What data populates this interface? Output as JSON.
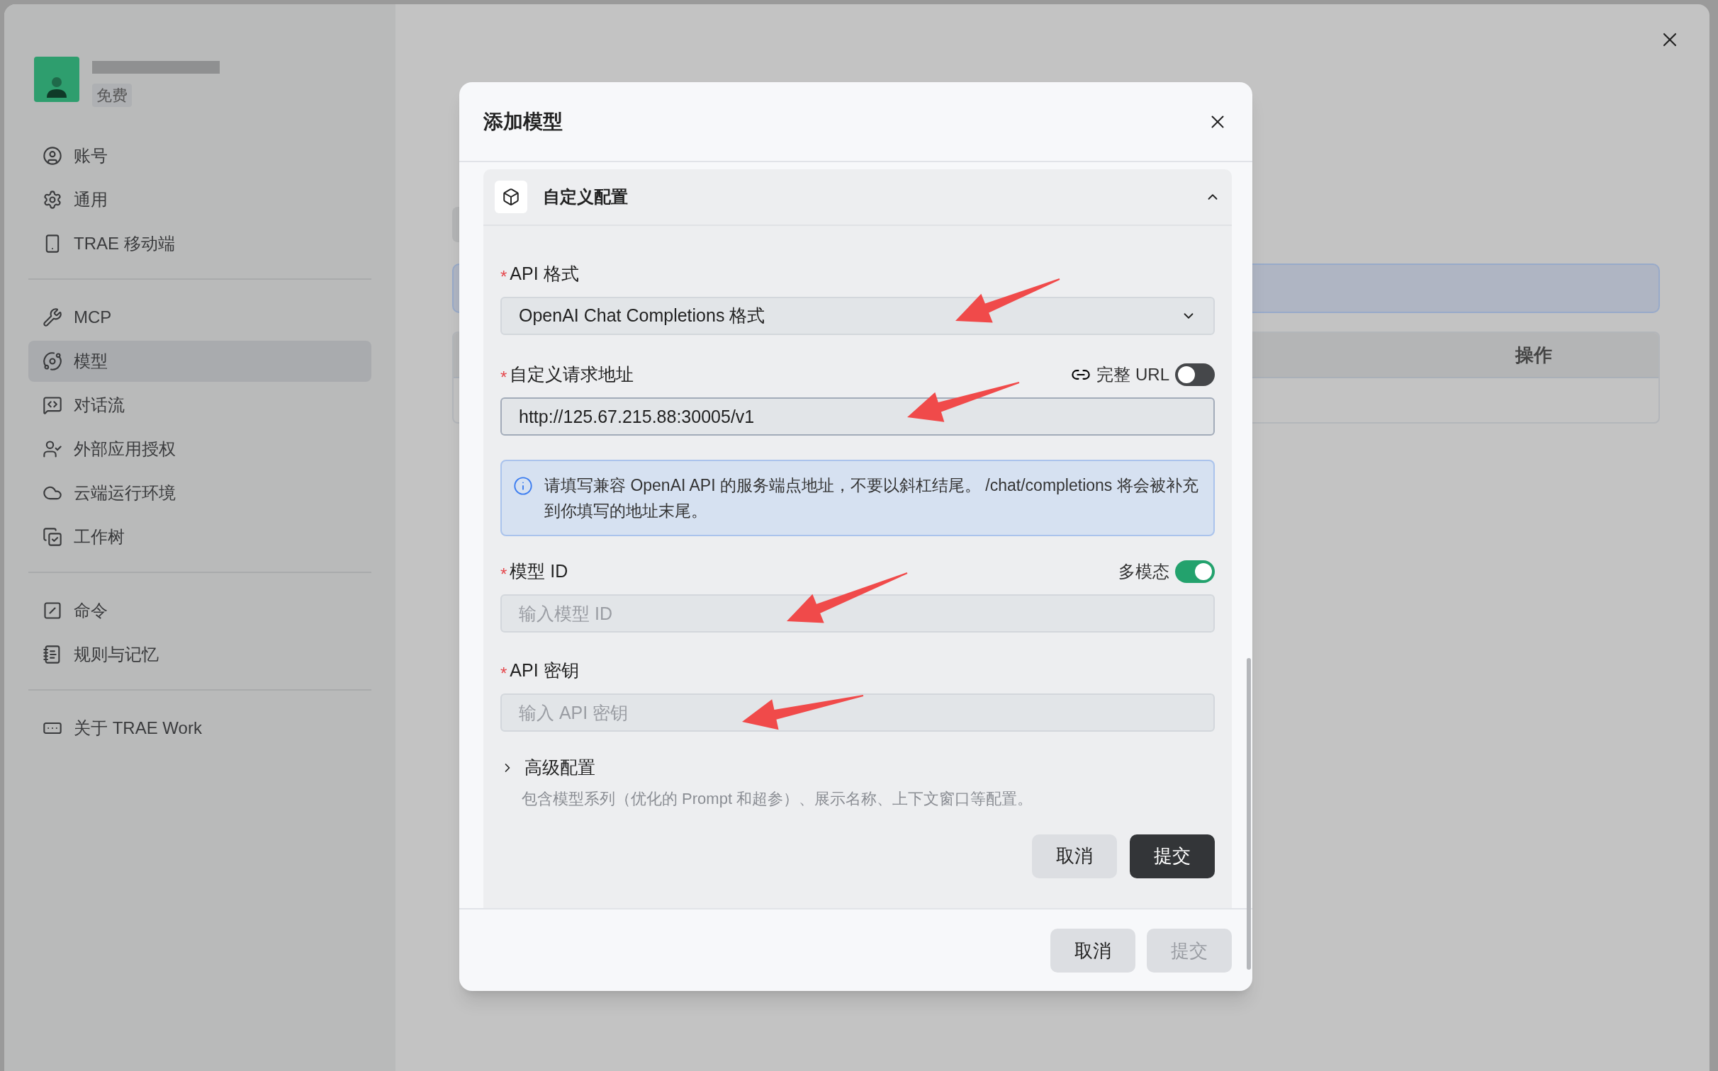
{
  "sidebar": {
    "account": {
      "badge": "免费"
    },
    "groups": [
      [
        {
          "label": "账号",
          "selected": false
        },
        {
          "label": "通用",
          "selected": false
        },
        {
          "label": "TRAE 移动端",
          "selected": false
        }
      ],
      [
        {
          "label": "MCP",
          "selected": false
        },
        {
          "label": "模型",
          "selected": true
        },
        {
          "label": "对话流",
          "selected": false
        },
        {
          "label": "外部应用授权",
          "selected": false
        },
        {
          "label": "云端运行环境",
          "selected": false
        },
        {
          "label": "工作树",
          "selected": false
        }
      ],
      [
        {
          "label": "命令",
          "selected": false
        },
        {
          "label": "规则与记忆",
          "selected": false
        }
      ],
      [
        {
          "label": "关于 TRAE Work",
          "selected": false
        }
      ]
    ]
  },
  "page": {
    "table": {
      "columns": [
        "操作"
      ]
    }
  },
  "dialog": {
    "title": "添加模型",
    "section": {
      "title": "自定义配置",
      "expanded": true,
      "api_format": {
        "required_mark": "*",
        "label": "API 格式",
        "value": "OpenAI Chat Completions 格式"
      },
      "endpoint": {
        "required_mark": "*",
        "label": "自定义请求地址",
        "toggle": {
          "label": "完整 URL",
          "on": false
        },
        "value": "http://125.67.215.88:30005/v1"
      },
      "hint": "请填写兼容 OpenAI API 的服务端点地址，不要以斜杠结尾。 /chat/completions 将会被补充到你填写的地址末尾。",
      "model_id": {
        "required_mark": "*",
        "label": "模型 ID",
        "toggle": {
          "label": "多模态",
          "on": true
        },
        "placeholder": "输入模型 ID"
      },
      "api_key": {
        "required_mark": "*",
        "label": "API 密钥",
        "placeholder": "输入 API 密钥"
      },
      "advanced": {
        "title": "高级配置",
        "expanded": false,
        "description": "包含模型系列（优化的 Prompt 和超参）、展示名称、上下文窗口等配置。"
      },
      "buttons": [
        {
          "label": "取消",
          "kind": "secondary",
          "disabled": false
        },
        {
          "label": "提交",
          "kind": "primary",
          "disabled": false
        }
      ]
    },
    "footer_buttons": [
      {
        "label": "取消",
        "disabled": false
      },
      {
        "label": "提交",
        "disabled": true
      }
    ]
  }
}
